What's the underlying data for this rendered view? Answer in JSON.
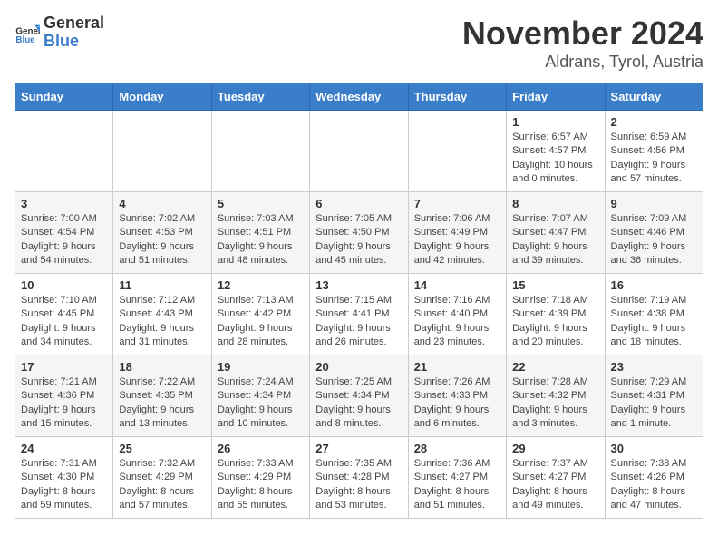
{
  "logo": {
    "text_general": "General",
    "text_blue": "Blue"
  },
  "header": {
    "month": "November 2024",
    "location": "Aldrans, Tyrol, Austria"
  },
  "days_of_week": [
    "Sunday",
    "Monday",
    "Tuesday",
    "Wednesday",
    "Thursday",
    "Friday",
    "Saturday"
  ],
  "weeks": [
    [
      {
        "day": "",
        "info": ""
      },
      {
        "day": "",
        "info": ""
      },
      {
        "day": "",
        "info": ""
      },
      {
        "day": "",
        "info": ""
      },
      {
        "day": "",
        "info": ""
      },
      {
        "day": "1",
        "info": "Sunrise: 6:57 AM\nSunset: 4:57 PM\nDaylight: 10 hours and 0 minutes."
      },
      {
        "day": "2",
        "info": "Sunrise: 6:59 AM\nSunset: 4:56 PM\nDaylight: 9 hours and 57 minutes."
      }
    ],
    [
      {
        "day": "3",
        "info": "Sunrise: 7:00 AM\nSunset: 4:54 PM\nDaylight: 9 hours and 54 minutes."
      },
      {
        "day": "4",
        "info": "Sunrise: 7:02 AM\nSunset: 4:53 PM\nDaylight: 9 hours and 51 minutes."
      },
      {
        "day": "5",
        "info": "Sunrise: 7:03 AM\nSunset: 4:51 PM\nDaylight: 9 hours and 48 minutes."
      },
      {
        "day": "6",
        "info": "Sunrise: 7:05 AM\nSunset: 4:50 PM\nDaylight: 9 hours and 45 minutes."
      },
      {
        "day": "7",
        "info": "Sunrise: 7:06 AM\nSunset: 4:49 PM\nDaylight: 9 hours and 42 minutes."
      },
      {
        "day": "8",
        "info": "Sunrise: 7:07 AM\nSunset: 4:47 PM\nDaylight: 9 hours and 39 minutes."
      },
      {
        "day": "9",
        "info": "Sunrise: 7:09 AM\nSunset: 4:46 PM\nDaylight: 9 hours and 36 minutes."
      }
    ],
    [
      {
        "day": "10",
        "info": "Sunrise: 7:10 AM\nSunset: 4:45 PM\nDaylight: 9 hours and 34 minutes."
      },
      {
        "day": "11",
        "info": "Sunrise: 7:12 AM\nSunset: 4:43 PM\nDaylight: 9 hours and 31 minutes."
      },
      {
        "day": "12",
        "info": "Sunrise: 7:13 AM\nSunset: 4:42 PM\nDaylight: 9 hours and 28 minutes."
      },
      {
        "day": "13",
        "info": "Sunrise: 7:15 AM\nSunset: 4:41 PM\nDaylight: 9 hours and 26 minutes."
      },
      {
        "day": "14",
        "info": "Sunrise: 7:16 AM\nSunset: 4:40 PM\nDaylight: 9 hours and 23 minutes."
      },
      {
        "day": "15",
        "info": "Sunrise: 7:18 AM\nSunset: 4:39 PM\nDaylight: 9 hours and 20 minutes."
      },
      {
        "day": "16",
        "info": "Sunrise: 7:19 AM\nSunset: 4:38 PM\nDaylight: 9 hours and 18 minutes."
      }
    ],
    [
      {
        "day": "17",
        "info": "Sunrise: 7:21 AM\nSunset: 4:36 PM\nDaylight: 9 hours and 15 minutes."
      },
      {
        "day": "18",
        "info": "Sunrise: 7:22 AM\nSunset: 4:35 PM\nDaylight: 9 hours and 13 minutes."
      },
      {
        "day": "19",
        "info": "Sunrise: 7:24 AM\nSunset: 4:34 PM\nDaylight: 9 hours and 10 minutes."
      },
      {
        "day": "20",
        "info": "Sunrise: 7:25 AM\nSunset: 4:34 PM\nDaylight: 9 hours and 8 minutes."
      },
      {
        "day": "21",
        "info": "Sunrise: 7:26 AM\nSunset: 4:33 PM\nDaylight: 9 hours and 6 minutes."
      },
      {
        "day": "22",
        "info": "Sunrise: 7:28 AM\nSunset: 4:32 PM\nDaylight: 9 hours and 3 minutes."
      },
      {
        "day": "23",
        "info": "Sunrise: 7:29 AM\nSunset: 4:31 PM\nDaylight: 9 hours and 1 minute."
      }
    ],
    [
      {
        "day": "24",
        "info": "Sunrise: 7:31 AM\nSunset: 4:30 PM\nDaylight: 8 hours and 59 minutes."
      },
      {
        "day": "25",
        "info": "Sunrise: 7:32 AM\nSunset: 4:29 PM\nDaylight: 8 hours and 57 minutes."
      },
      {
        "day": "26",
        "info": "Sunrise: 7:33 AM\nSunset: 4:29 PM\nDaylight: 8 hours and 55 minutes."
      },
      {
        "day": "27",
        "info": "Sunrise: 7:35 AM\nSunset: 4:28 PM\nDaylight: 8 hours and 53 minutes."
      },
      {
        "day": "28",
        "info": "Sunrise: 7:36 AM\nSunset: 4:27 PM\nDaylight: 8 hours and 51 minutes."
      },
      {
        "day": "29",
        "info": "Sunrise: 7:37 AM\nSunset: 4:27 PM\nDaylight: 8 hours and 49 minutes."
      },
      {
        "day": "30",
        "info": "Sunrise: 7:38 AM\nSunset: 4:26 PM\nDaylight: 8 hours and 47 minutes."
      }
    ]
  ]
}
